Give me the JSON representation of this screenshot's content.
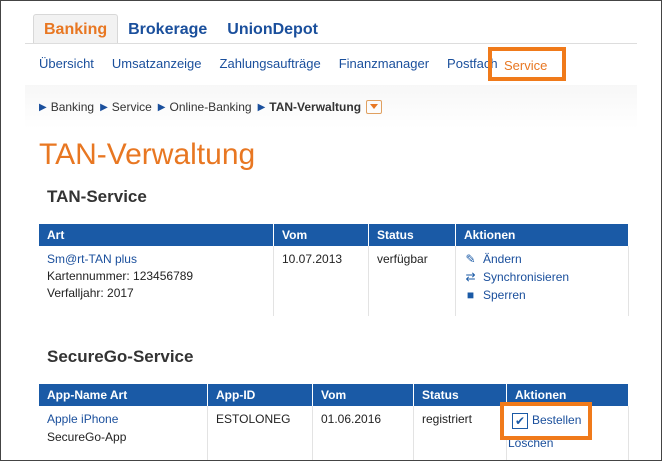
{
  "top_tabs": [
    "Banking",
    "Brokerage",
    "UnionDepot"
  ],
  "subnav": {
    "items": [
      "Übersicht",
      "Umsatzanzeige",
      "Zahlungsaufträge",
      "Finanzmanager",
      "Postfach"
    ],
    "service": "Service"
  },
  "breadcrumb": {
    "items": [
      "Banking",
      "Service",
      "Online-Banking"
    ],
    "current": "TAN-Verwaltung"
  },
  "page_title": "TAN-Verwaltung",
  "tan_service": {
    "title": "TAN-Service",
    "headers": [
      "Art",
      "Vom",
      "Status",
      "Aktionen"
    ],
    "row": {
      "art_link": "Sm@rt-TAN plus",
      "art_line2": "Kartennummer: 123456789",
      "art_line3": "Verfalljahr: 2017",
      "vom": "10.07.2013",
      "status": "verfügbar",
      "actions": [
        "Ändern",
        "Synchronisieren",
        "Sperren"
      ]
    }
  },
  "securego": {
    "title": "SecureGo-Service",
    "headers": [
      "App-Name Art",
      "App-ID",
      "Vom",
      "Status",
      "Aktionen"
    ],
    "row": {
      "app_name": "Apple iPhone",
      "app_art": "SecureGo-App",
      "app_id": "ESTOLONEG",
      "vom": "01.06.2016",
      "status": "registriert",
      "actions": [
        "Bestellen",
        "Löschen"
      ]
    }
  },
  "colors": {
    "accent": "#e87722",
    "primary": "#1a5aa6",
    "highlight": "#f07a1a"
  }
}
